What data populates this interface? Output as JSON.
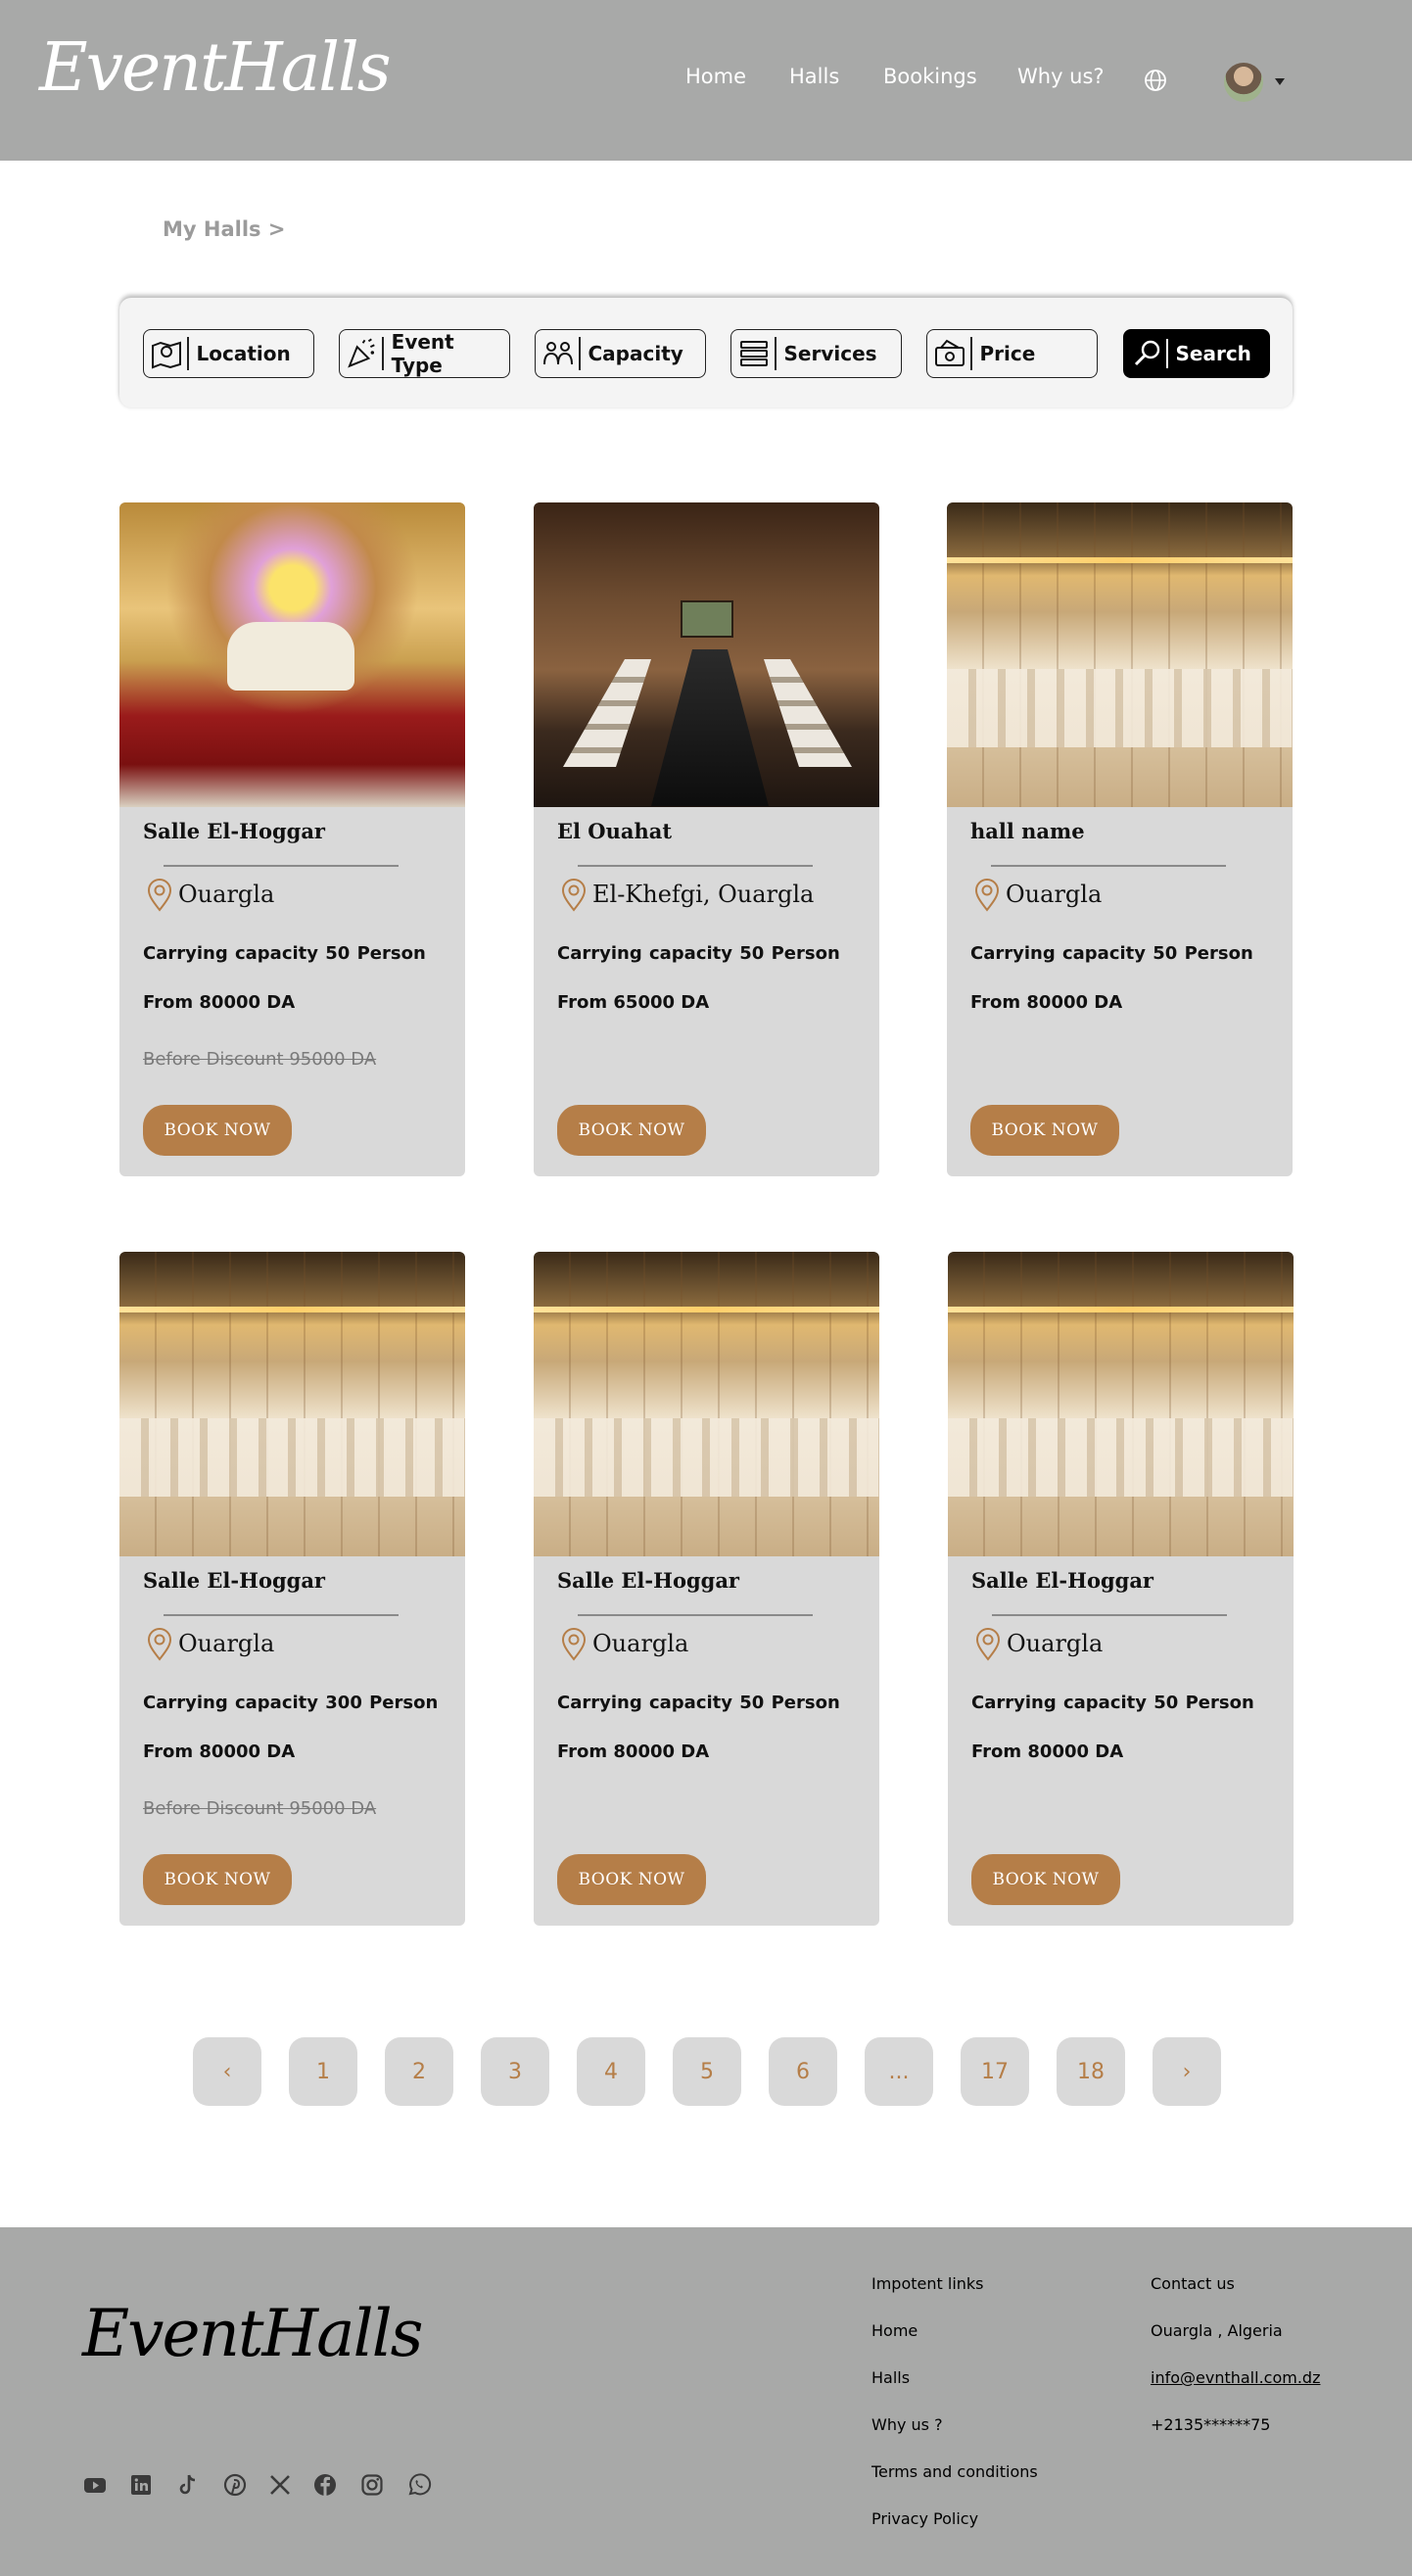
{
  "header": {
    "logo": "EventHalls",
    "nav": [
      "Home",
      "Halls",
      "Bookings",
      "Why us?"
    ]
  },
  "breadcrumb": "My Halls  >",
  "filters": {
    "location": "Location",
    "event_type": "Event Type",
    "capacity": "Capacity",
    "services": "Services",
    "price": "Price",
    "search": "Search"
  },
  "book_label": "BOOK NOW",
  "halls": [
    {
      "name": "Salle El-Hoggar",
      "location": "Ouargla",
      "capacity": "Carrying capacity  50 Person",
      "price": "From 80000 DA",
      "discount": "Before Discount  95000 DA ",
      "photo": "wedding"
    },
    {
      "name": "El Ouahat",
      "location": "El-Khefgi, Ouargla",
      "capacity": "Carrying capacity  50 Person",
      "price": "From 65000 DA",
      "discount": "",
      "photo": "meeting"
    },
    {
      "name": "hall name",
      "location": "Ouargla",
      "capacity": "Carrying capacity  50 Person",
      "price": "From 80000 DA",
      "discount": "",
      "photo": "ballroom"
    },
    {
      "name": "Salle El-Hoggar",
      "location": "Ouargla",
      "capacity": "Carrying capacity  300 Person",
      "price": "From 80000 DA",
      "discount": "Before Discount  95000 DA ",
      "photo": "ballroom"
    },
    {
      "name": "Salle El-Hoggar",
      "location": "Ouargla",
      "capacity": "Carrying capacity  50 Person",
      "price": "From 80000 DA",
      "discount": "",
      "photo": "ballroom"
    },
    {
      "name": "Salle El-Hoggar",
      "location": "Ouargla",
      "capacity": "Carrying capacity  50 Person",
      "price": "From 80000 DA",
      "discount": "",
      "photo": "ballroom"
    }
  ],
  "pagination": {
    "prev": "‹",
    "pages": [
      "1",
      "2",
      "3",
      "4",
      "5",
      "6",
      "...",
      "17",
      "18"
    ],
    "next": "›"
  },
  "footer": {
    "logo": "EventHalls",
    "links_title": "Impotent links",
    "links": [
      "Home",
      "Halls",
      "Why us ?",
      "Terms and conditions",
      "Privacy Policy"
    ],
    "contact_title": "Contact us",
    "address": "Ouargla , Algeria",
    "email": "info@evnthall.com.dz",
    "phone": "+2135******75",
    "social_icons": [
      "youtube-icon",
      "linkedin-icon",
      "tiktok-icon",
      "pinterest-icon",
      "x-icon",
      "facebook-icon",
      "instagram-icon",
      "whatsapp-icon"
    ]
  },
  "colors": {
    "header_bg": "#a8a9a8",
    "accent": "#b57e48",
    "card_bg": "#d9d9d9"
  }
}
